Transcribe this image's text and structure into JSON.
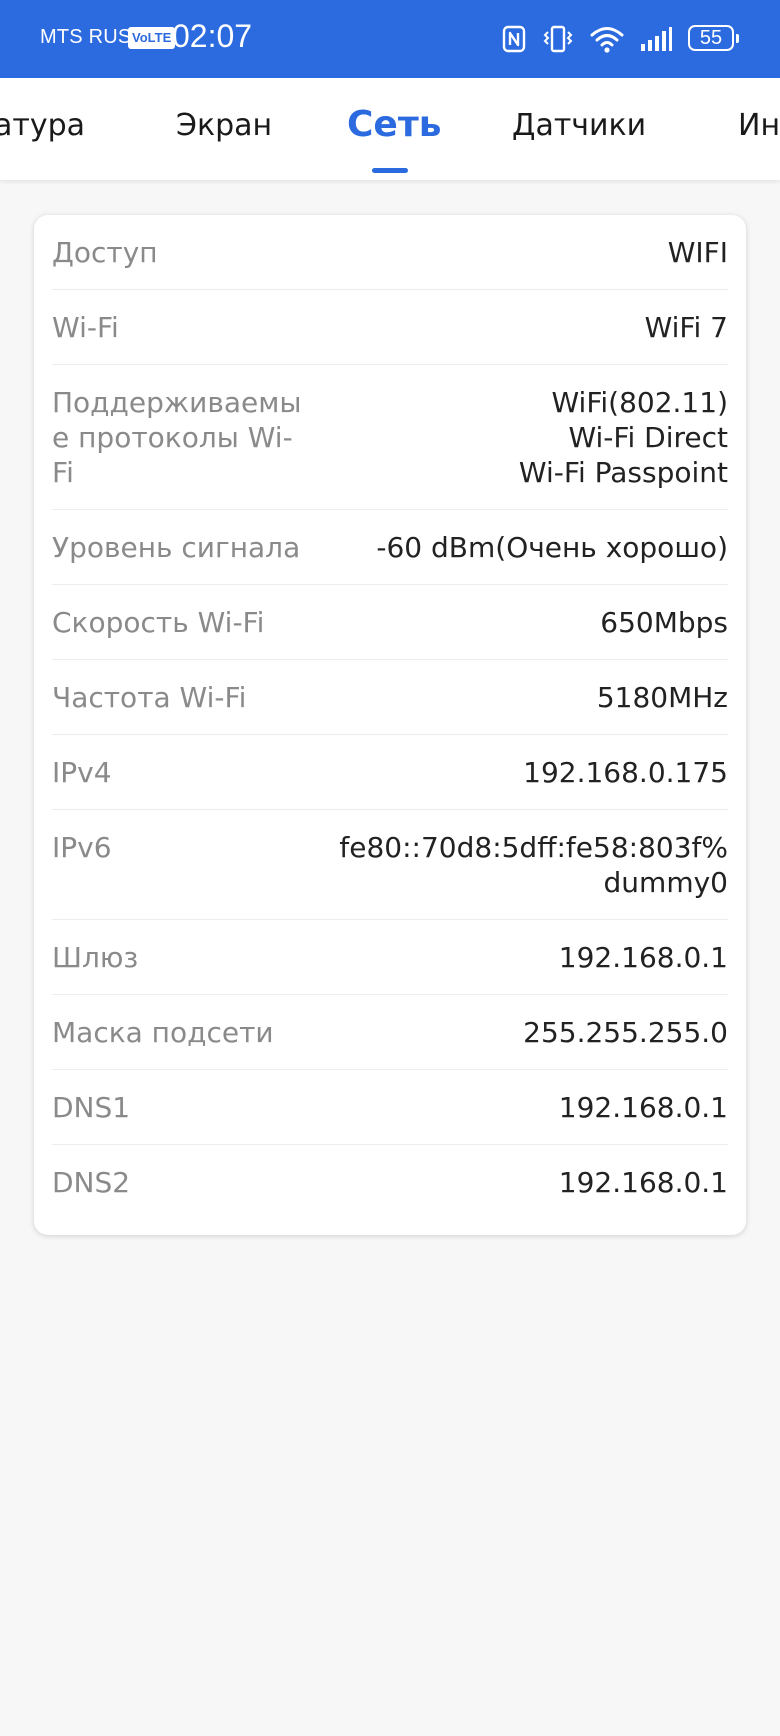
{
  "status_bar": {
    "carrier": "MTS RUS",
    "volte": "VoLTE",
    "time": "02:07",
    "battery": "55",
    "icons": [
      "nfc-icon",
      "vibrate-icon",
      "wifi-icon",
      "signal-icon",
      "battery-icon"
    ]
  },
  "tabs": [
    {
      "label": "атура"
    },
    {
      "label": "Экран"
    },
    {
      "label": "Сеть",
      "active": true
    },
    {
      "label": "Датчики"
    },
    {
      "label": "Ин"
    }
  ],
  "network": {
    "rows": [
      {
        "label": "Доступ",
        "value": "WIFI"
      },
      {
        "label": "Wi-Fi",
        "value": "WiFi 7"
      },
      {
        "label": "Поддерживаемые протоколы Wi-Fi",
        "value": "WiFi(802.11)\nWi-Fi Direct\nWi-Fi Passpoint"
      },
      {
        "label": "Уровень сигнала",
        "value": "-60 dBm(Очень хорошо)"
      },
      {
        "label": "Скорость Wi-Fi",
        "value": "650Mbps"
      },
      {
        "label": "Частота Wi-Fi",
        "value": "5180MHz"
      },
      {
        "label": "IPv4",
        "value": "192.168.0.175"
      },
      {
        "label": "IPv6",
        "value": "fe80::70d8:5dff:fe58:803f%\ndummy0"
      },
      {
        "label": "Шлюз",
        "value": "192.168.0.1"
      },
      {
        "label": "Маска подсети",
        "value": "255.255.255.0"
      },
      {
        "label": "DNS1",
        "value": "192.168.0.1"
      },
      {
        "label": "DNS2",
        "value": "192.168.0.1"
      }
    ]
  },
  "colors": {
    "accent": "#2b6bdf",
    "label": "#8a8a8a",
    "value": "#222222",
    "background": "#f7f7f7"
  }
}
